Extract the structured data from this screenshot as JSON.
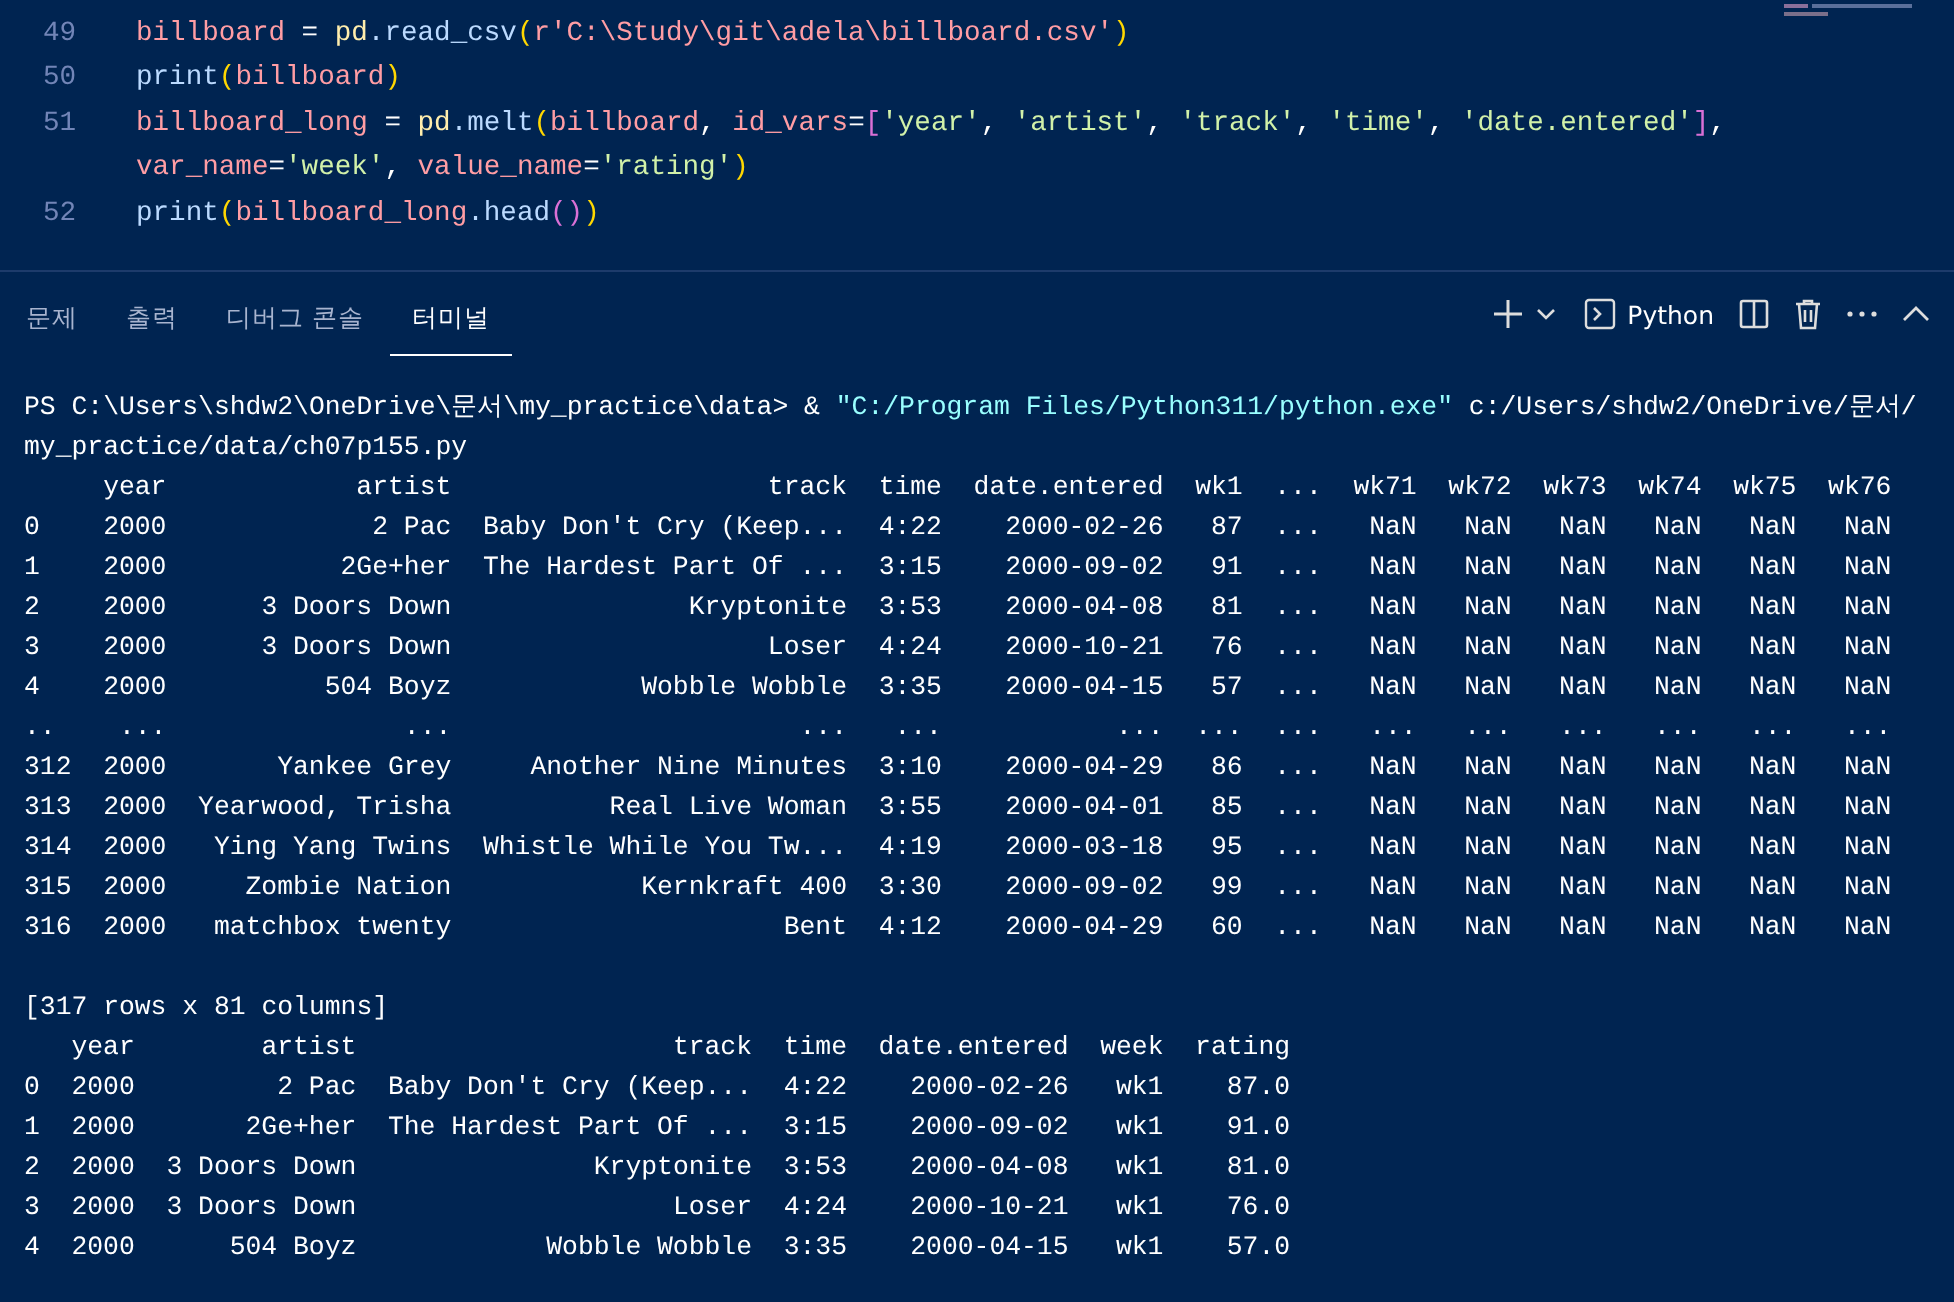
{
  "editor": {
    "lines": [
      {
        "number": "49",
        "tokens": [
          {
            "text": "billboard",
            "kind": "var"
          },
          {
            "text": " = ",
            "kind": "op"
          },
          {
            "text": "pd",
            "kind": "module"
          },
          {
            "text": ".read_csv",
            "kind": "func"
          },
          {
            "text": "(",
            "kind": "b1"
          },
          {
            "text": "r'C:\\Study\\git\\adela\\billboard.csv'",
            "kind": "rstr"
          },
          {
            "text": ")",
            "kind": "b1"
          }
        ]
      },
      {
        "number": "50",
        "tokens": [
          {
            "text": "print",
            "kind": "func"
          },
          {
            "text": "(",
            "kind": "b1"
          },
          {
            "text": "billboard",
            "kind": "var"
          },
          {
            "text": ")",
            "kind": "b1"
          }
        ]
      },
      {
        "number": "51",
        "tokens": [
          {
            "text": "billboard_long",
            "kind": "var"
          },
          {
            "text": " = ",
            "kind": "op"
          },
          {
            "text": "pd",
            "kind": "module"
          },
          {
            "text": ".melt",
            "kind": "func"
          },
          {
            "text": "(",
            "kind": "b1"
          },
          {
            "text": "billboard",
            "kind": "var"
          },
          {
            "text": ", ",
            "kind": "op"
          },
          {
            "text": "id_vars",
            "kind": "var"
          },
          {
            "text": "=",
            "kind": "op"
          },
          {
            "text": "[",
            "kind": "b2"
          },
          {
            "text": "'year'",
            "kind": "str"
          },
          {
            "text": ", ",
            "kind": "op"
          },
          {
            "text": "'artist'",
            "kind": "str"
          },
          {
            "text": ", ",
            "kind": "op"
          },
          {
            "text": "'track'",
            "kind": "str"
          },
          {
            "text": ", ",
            "kind": "op"
          },
          {
            "text": "'time'",
            "kind": "str"
          },
          {
            "text": ", ",
            "kind": "op"
          },
          {
            "text": "'date.entered'",
            "kind": "str"
          },
          {
            "text": "]",
            "kind": "b2"
          },
          {
            "text": ", ",
            "kind": "op"
          },
          {
            "text": "var_name",
            "kind": "var"
          },
          {
            "text": "=",
            "kind": "op"
          },
          {
            "text": "'week'",
            "kind": "str"
          },
          {
            "text": ", ",
            "kind": "op"
          },
          {
            "text": "value_name",
            "kind": "var"
          },
          {
            "text": "=",
            "kind": "op"
          },
          {
            "text": "'rating'",
            "kind": "str"
          },
          {
            "text": ")",
            "kind": "b1"
          }
        ]
      },
      {
        "number": "52",
        "tokens": [
          {
            "text": "print",
            "kind": "func"
          },
          {
            "text": "(",
            "kind": "b1"
          },
          {
            "text": "billboard_long",
            "kind": "var"
          },
          {
            "text": ".head",
            "kind": "func"
          },
          {
            "text": "(",
            "kind": "b2"
          },
          {
            "text": ")",
            "kind": "b2"
          },
          {
            "text": ")",
            "kind": "b1"
          }
        ]
      }
    ]
  },
  "panel": {
    "tabs": [
      {
        "label": "문제",
        "selected": false
      },
      {
        "label": "출력",
        "selected": false
      },
      {
        "label": "디버그 콘솔",
        "selected": false
      },
      {
        "label": "터미널",
        "selected": true
      }
    ],
    "terminal_profile": "Python"
  },
  "terminal": {
    "command": {
      "prompt": "PS C:\\Users\\shdw2\\OneDrive\\문서\\my_practice\\data> &",
      "executable": "\"C:/Program Files/Python311/python.exe\"",
      "argument": "c:/Users/shdw2/OneDrive/문서/"
    },
    "command_continued": "my_practice/data/ch07p155.py",
    "table_1": {
      "columns": [
        "year",
        "artist",
        "track",
        "time",
        "date.entered",
        "wk1",
        "...",
        "wk71",
        "wk72",
        "wk73",
        "wk74",
        "wk75",
        "wk76"
      ],
      "rows": [
        {
          "index": "0",
          "cells": [
            "2000",
            "2 Pac",
            "Baby Don't Cry (Keep...",
            "4:22",
            "2000-02-26",
            "87",
            "...",
            "NaN",
            "NaN",
            "NaN",
            "NaN",
            "NaN",
            "NaN"
          ]
        },
        {
          "index": "1",
          "cells": [
            "2000",
            "2Ge+her",
            "The Hardest Part Of ...",
            "3:15",
            "2000-09-02",
            "91",
            "...",
            "NaN",
            "NaN",
            "NaN",
            "NaN",
            "NaN",
            "NaN"
          ]
        },
        {
          "index": "2",
          "cells": [
            "2000",
            "3 Doors Down",
            "Kryptonite",
            "3:53",
            "2000-04-08",
            "81",
            "...",
            "NaN",
            "NaN",
            "NaN",
            "NaN",
            "NaN",
            "NaN"
          ]
        },
        {
          "index": "3",
          "cells": [
            "2000",
            "3 Doors Down",
            "Loser",
            "4:24",
            "2000-10-21",
            "76",
            "...",
            "NaN",
            "NaN",
            "NaN",
            "NaN",
            "NaN",
            "NaN"
          ]
        },
        {
          "index": "4",
          "cells": [
            "2000",
            "504 Boyz",
            "Wobble Wobble",
            "3:35",
            "2000-04-15",
            "57",
            "...",
            "NaN",
            "NaN",
            "NaN",
            "NaN",
            "NaN",
            "NaN"
          ]
        },
        {
          "index": "..",
          "cells": [
            "...",
            "...",
            "...",
            "...",
            "...",
            "...",
            "...",
            "...",
            "...",
            "...",
            "...",
            "...",
            "..."
          ]
        },
        {
          "index": "312",
          "cells": [
            "2000",
            "Yankee Grey",
            "Another Nine Minutes",
            "3:10",
            "2000-04-29",
            "86",
            "...",
            "NaN",
            "NaN",
            "NaN",
            "NaN",
            "NaN",
            "NaN"
          ]
        },
        {
          "index": "313",
          "cells": [
            "2000",
            "Yearwood, Trisha",
            "Real Live Woman",
            "3:55",
            "2000-04-01",
            "85",
            "...",
            "NaN",
            "NaN",
            "NaN",
            "NaN",
            "NaN",
            "NaN"
          ]
        },
        {
          "index": "314",
          "cells": [
            "2000",
            "Ying Yang Twins",
            "Whistle While You Tw...",
            "4:19",
            "2000-03-18",
            "95",
            "...",
            "NaN",
            "NaN",
            "NaN",
            "NaN",
            "NaN",
            "NaN"
          ]
        },
        {
          "index": "315",
          "cells": [
            "2000",
            "Zombie Nation",
            "Kernkraft 400",
            "3:30",
            "2000-09-02",
            "99",
            "...",
            "NaN",
            "NaN",
            "NaN",
            "NaN",
            "NaN",
            "NaN"
          ]
        },
        {
          "index": "316",
          "cells": [
            "2000",
            "matchbox twenty",
            "Bent",
            "4:12",
            "2000-04-29",
            "60",
            "...",
            "NaN",
            "NaN",
            "NaN",
            "NaN",
            "NaN",
            "NaN"
          ]
        }
      ]
    },
    "summary": "[317 rows x 81 columns]",
    "table_2": {
      "columns": [
        "year",
        "artist",
        "track",
        "time",
        "date.entered",
        "week",
        "rating"
      ],
      "rows": [
        {
          "index": "0",
          "cells": [
            "2000",
            "2 Pac",
            "Baby Don't Cry (Keep...",
            "4:22",
            "2000-02-26",
            "wk1",
            "87.0"
          ]
        },
        {
          "index": "1",
          "cells": [
            "2000",
            "2Ge+her",
            "The Hardest Part Of ...",
            "3:15",
            "2000-09-02",
            "wk1",
            "91.0"
          ]
        },
        {
          "index": "2",
          "cells": [
            "2000",
            "3 Doors Down",
            "Kryptonite",
            "3:53",
            "2000-04-08",
            "wk1",
            "81.0"
          ]
        },
        {
          "index": "3",
          "cells": [
            "2000",
            "3 Doors Down",
            "Loser",
            "4:24",
            "2000-10-21",
            "wk1",
            "76.0"
          ]
        },
        {
          "index": "4",
          "cells": [
            "2000",
            "504 Boyz",
            "Wobble Wobble",
            "3:35",
            "2000-04-15",
            "wk1",
            "57.0"
          ]
        }
      ]
    }
  }
}
